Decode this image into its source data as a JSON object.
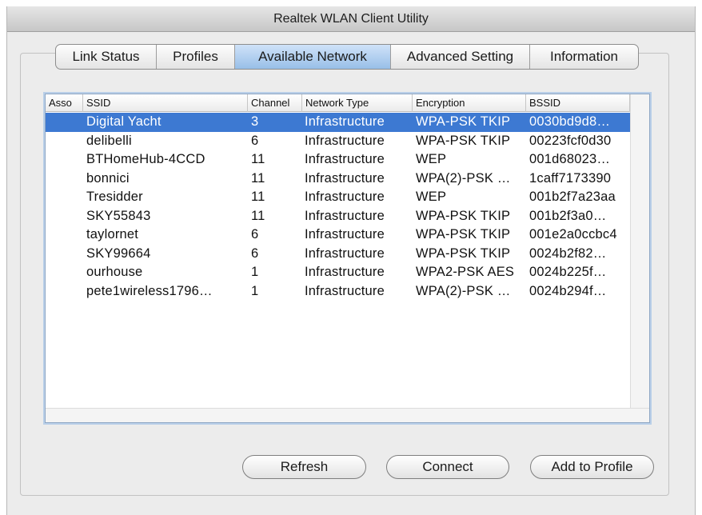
{
  "window": {
    "title": "Realtek WLAN Client Utility"
  },
  "tabs": [
    {
      "label": "Link Status"
    },
    {
      "label": "Profiles"
    },
    {
      "label": "Available Network"
    },
    {
      "label": "Advanced Setting"
    },
    {
      "label": "Information"
    }
  ],
  "table": {
    "headers": [
      "Asso",
      "SSID",
      "Channel",
      "Network Type",
      "Encryption",
      "BSSID"
    ],
    "rows": [
      {
        "asso": "",
        "ssid": "Digital Yacht",
        "channel": "3",
        "type": "Infrastructure",
        "encryption": "WPA-PSK TKIP",
        "bssid": "0030bd9d8…"
      },
      {
        "asso": "",
        "ssid": "delibelli",
        "channel": "6",
        "type": "Infrastructure",
        "encryption": "WPA-PSK TKIP",
        "bssid": "00223fcf0d30"
      },
      {
        "asso": "",
        "ssid": "BTHomeHub-4CCD",
        "channel": "11",
        "type": "Infrastructure",
        "encryption": "WEP",
        "bssid": "001d68023…"
      },
      {
        "asso": "",
        "ssid": "bonnici",
        "channel": "11",
        "type": "Infrastructure",
        "encryption": "WPA(2)-PSK …",
        "bssid": "1caff7173390"
      },
      {
        "asso": "",
        "ssid": "Tresidder",
        "channel": "11",
        "type": "Infrastructure",
        "encryption": "WEP",
        "bssid": "001b2f7a23aa"
      },
      {
        "asso": "",
        "ssid": "SKY55843",
        "channel": "11",
        "type": "Infrastructure",
        "encryption": "WPA-PSK TKIP",
        "bssid": "001b2f3a0…"
      },
      {
        "asso": "",
        "ssid": "taylornet",
        "channel": "6",
        "type": "Infrastructure",
        "encryption": "WPA-PSK TKIP",
        "bssid": "001e2a0ccbc4"
      },
      {
        "asso": "",
        "ssid": "SKY99664",
        "channel": "6",
        "type": "Infrastructure",
        "encryption": "WPA-PSK TKIP",
        "bssid": "0024b2f82…"
      },
      {
        "asso": "",
        "ssid": "ourhouse",
        "channel": "1",
        "type": "Infrastructure",
        "encryption": "WPA2-PSK AES",
        "bssid": "0024b225f…"
      },
      {
        "asso": "",
        "ssid": "pete1wireless1796…",
        "channel": "1",
        "type": "Infrastructure",
        "encryption": "WPA(2)-PSK …",
        "bssid": "0024b294f…"
      }
    ]
  },
  "buttons": {
    "refresh": "Refresh",
    "connect": "Connect",
    "add_profile": "Add to Profile"
  },
  "colors": {
    "selection": "#3d79d2",
    "active_tab": "#98bfe8"
  }
}
